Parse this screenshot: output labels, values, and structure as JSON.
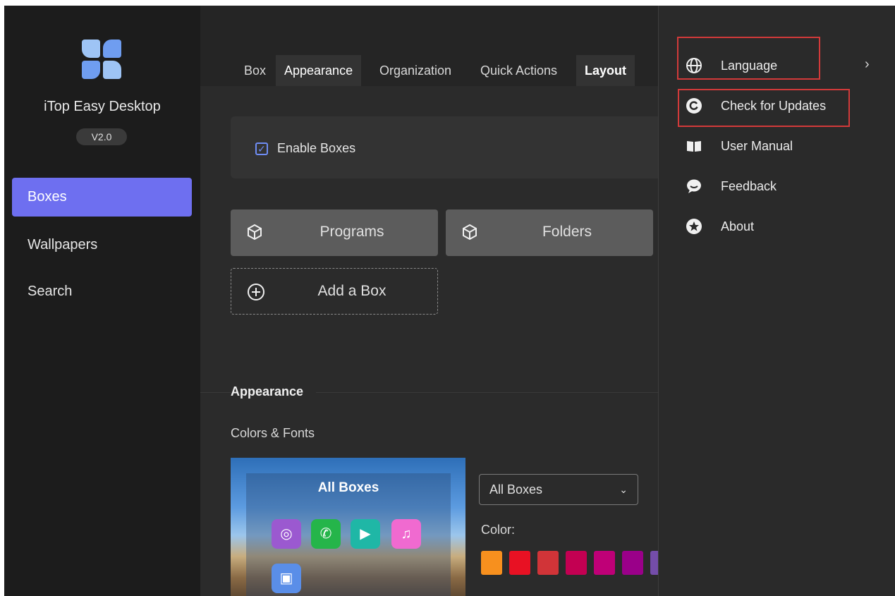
{
  "app": {
    "name": "iTop Easy Desktop",
    "version": "V2.0"
  },
  "sidebar": {
    "items": [
      {
        "label": "Boxes",
        "active": true
      },
      {
        "label": "Wallpapers",
        "active": false
      },
      {
        "label": "Search",
        "active": false
      }
    ]
  },
  "tabs": [
    {
      "label": "Box"
    },
    {
      "label": "Appearance",
      "selected": true
    },
    {
      "label": "Organization"
    },
    {
      "label": "Quick Actions"
    },
    {
      "label": "Layout",
      "bold": true
    }
  ],
  "enable_boxes": {
    "label": "Enable Boxes",
    "checked": true
  },
  "box_buttons": {
    "programs": "Programs",
    "folders": "Folders",
    "add": "Add a Box"
  },
  "appearance": {
    "section_title": "Appearance",
    "subtitle": "Colors & Fonts",
    "preview_title": "All Boxes",
    "dropdown_value": "All Boxes",
    "color_label": "Color:",
    "swatches": [
      "#f7901e",
      "#e81123",
      "#d13438",
      "#c30052",
      "#bf0077",
      "#9a0089",
      "#744da9"
    ]
  },
  "menu": {
    "items": [
      {
        "label": "Language",
        "icon": "globe-icon",
        "highlighted": true,
        "submenu": true
      },
      {
        "label": "Check for Updates",
        "icon": "refresh-icon",
        "highlighted": true
      },
      {
        "label": "User Manual",
        "icon": "book-icon"
      },
      {
        "label": "Feedback",
        "icon": "chat-bubble-icon"
      },
      {
        "label": "About",
        "icon": "star-icon"
      }
    ]
  },
  "colors": {
    "accent": "#6e6ff0",
    "highlight_box": "#d23a3a"
  }
}
